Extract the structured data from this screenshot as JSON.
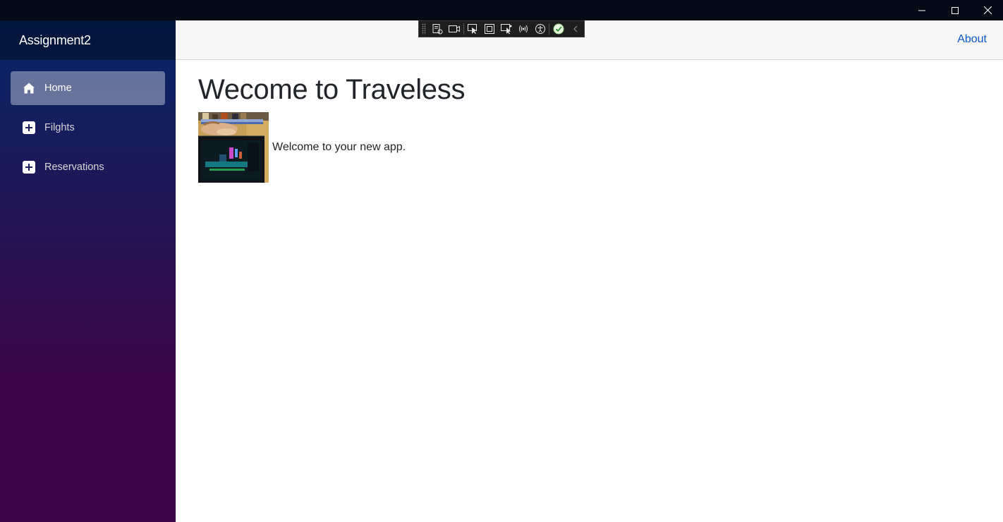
{
  "window": {
    "minimize_icon": "minimize-icon",
    "maximize_icon": "maximize-icon",
    "close_icon": "close-icon"
  },
  "sidebar": {
    "brand": "Assignment2",
    "items": [
      {
        "label": "Home",
        "icon": "home-icon",
        "active": true
      },
      {
        "label": "Filghts",
        "icon": "plus-icon",
        "active": false
      },
      {
        "label": "Reservations",
        "icon": "plus-icon",
        "active": false
      }
    ],
    "gradient_top": "#052767",
    "gradient_bottom": "#3a0647"
  },
  "header": {
    "about_label": "About",
    "link_color": "#0a58ca"
  },
  "devtools": {
    "icons": [
      "live-visual-tree-icon",
      "record-icon",
      "select-element-icon",
      "display-layout-adorners-icon",
      "track-focus-icon",
      "binding-failures-icon",
      "accessibility-icon",
      "hot-reload-status-icon",
      "collapse-chevron-icon"
    ]
  },
  "main": {
    "title": "Wecome to Traveless",
    "photo_icon": "cat-photo",
    "welcome_text": "Welcome to your new app."
  }
}
